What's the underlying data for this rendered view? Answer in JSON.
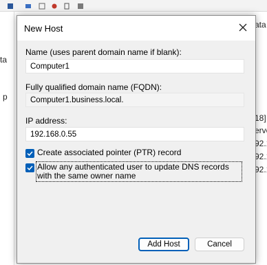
{
  "background": {
    "left_partial": [
      "ta",
      "p"
    ],
    "right_partial": [
      "ata",
      "18]",
      "erve",
      "92.1",
      "92.1",
      "92.1"
    ]
  },
  "dialog": {
    "title": "New Host",
    "name_label": "Name (uses parent domain name if blank):",
    "name_value": "Computer1",
    "fqdn_label": "Fully qualified domain name (FQDN):",
    "fqdn_value": "Computer1.business.local.",
    "ip_label": "IP address:",
    "ip_value": "192.168.0.55",
    "ptr_label": "Create associated pointer (PTR) record",
    "ptr_checked": true,
    "allow_label": "Allow any authenticated user to update DNS records with the same owner name",
    "allow_checked": true,
    "add_host_label": "Add Host",
    "cancel_label": "Cancel"
  },
  "colors": {
    "accent": "#005fb8"
  }
}
